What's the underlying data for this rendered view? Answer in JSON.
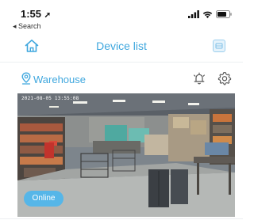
{
  "status_bar": {
    "time": "1:55",
    "back_label": "◂ Search"
  },
  "nav": {
    "title": "Device list",
    "accent_color": "#3fa7de"
  },
  "location": {
    "name": "Warehouse"
  },
  "camera": {
    "timestamp": "2021-08-05 13:55:08",
    "status": "Online",
    "status_color": "#56b6e8"
  }
}
